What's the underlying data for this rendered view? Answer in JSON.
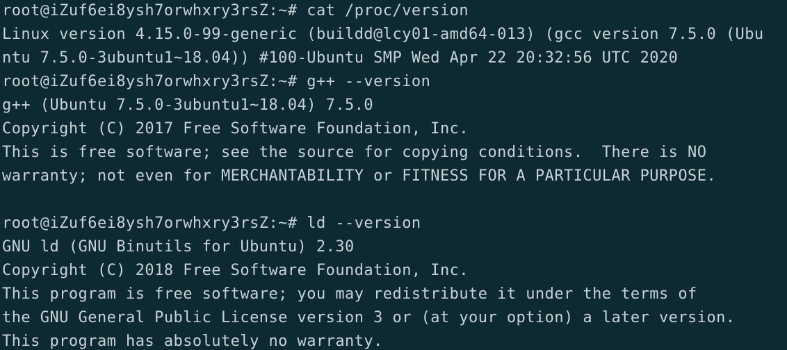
{
  "terminal": {
    "foreground_color": "#c8d2d6",
    "background_color": "#0d2a33",
    "lines": [
      "root@iZuf6ei8ysh7orwhxry3rsZ:~# cat /proc/version",
      "Linux version 4.15.0-99-generic (buildd@lcy01-amd64-013) (gcc version 7.5.0 (Ubu",
      "ntu 7.5.0-3ubuntu1~18.04)) #100-Ubuntu SMP Wed Apr 22 20:32:56 UTC 2020",
      "root@iZuf6ei8ysh7orwhxry3rsZ:~# g++ --version",
      "g++ (Ubuntu 7.5.0-3ubuntu1~18.04) 7.5.0",
      "Copyright (C) 2017 Free Software Foundation, Inc.",
      "This is free software; see the source for copying conditions.  There is NO",
      "warranty; not even for MERCHANTABILITY or FITNESS FOR A PARTICULAR PURPOSE.",
      "",
      "root@iZuf6ei8ysh7orwhxry3rsZ:~# ld --version",
      "GNU ld (GNU Binutils for Ubuntu) 2.30",
      "Copyright (C) 2018 Free Software Foundation, Inc.",
      "This program is free software; you may redistribute it under the terms of",
      "the GNU General Public License version 3 or (at your option) a later version.",
      "This program has absolutely no warranty."
    ]
  }
}
